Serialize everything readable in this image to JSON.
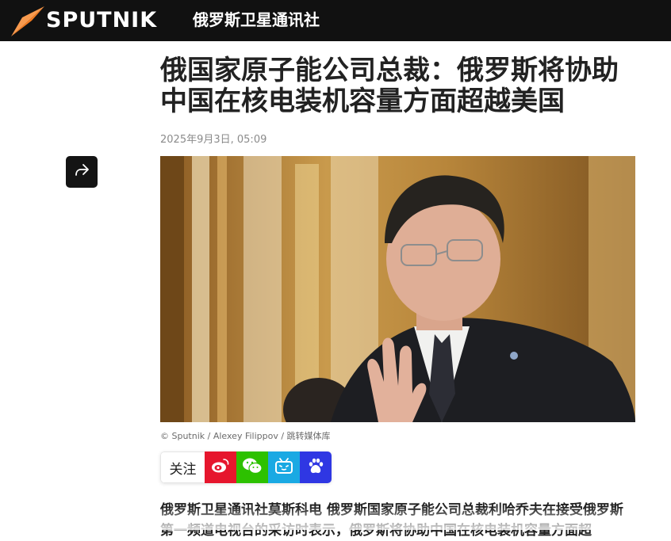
{
  "header": {
    "brand": "SPUTNIK",
    "site_name": "俄罗斯卫星通讯社"
  },
  "article": {
    "title": "俄国家原子能公司总裁：俄罗斯将协助中国在核电装机容量方面超越美国",
    "date": "2025年9月3日, 05:09",
    "photo_credit": "© Sputnik / Alexey Filippov / 跳转媒体库",
    "lead": "俄罗斯卫星通讯社莫斯科电 俄罗斯国家原子能公司总裁利哈乔夫在接受俄罗斯第一频道电视台的采访时表示，俄罗斯将协助中国在核电装机容量方面超"
  },
  "social": {
    "follow_label": "关注",
    "icons": [
      "weibo-icon",
      "wechat-icon",
      "bilibili-icon",
      "baidu-icon"
    ]
  },
  "colors": {
    "topbar": "#111111",
    "logo_orange": "#f47b20",
    "weibo": "#e6162d",
    "wechat": "#2dc100",
    "bilibili": "#1aa9e3",
    "baidu": "#2f37e3"
  }
}
